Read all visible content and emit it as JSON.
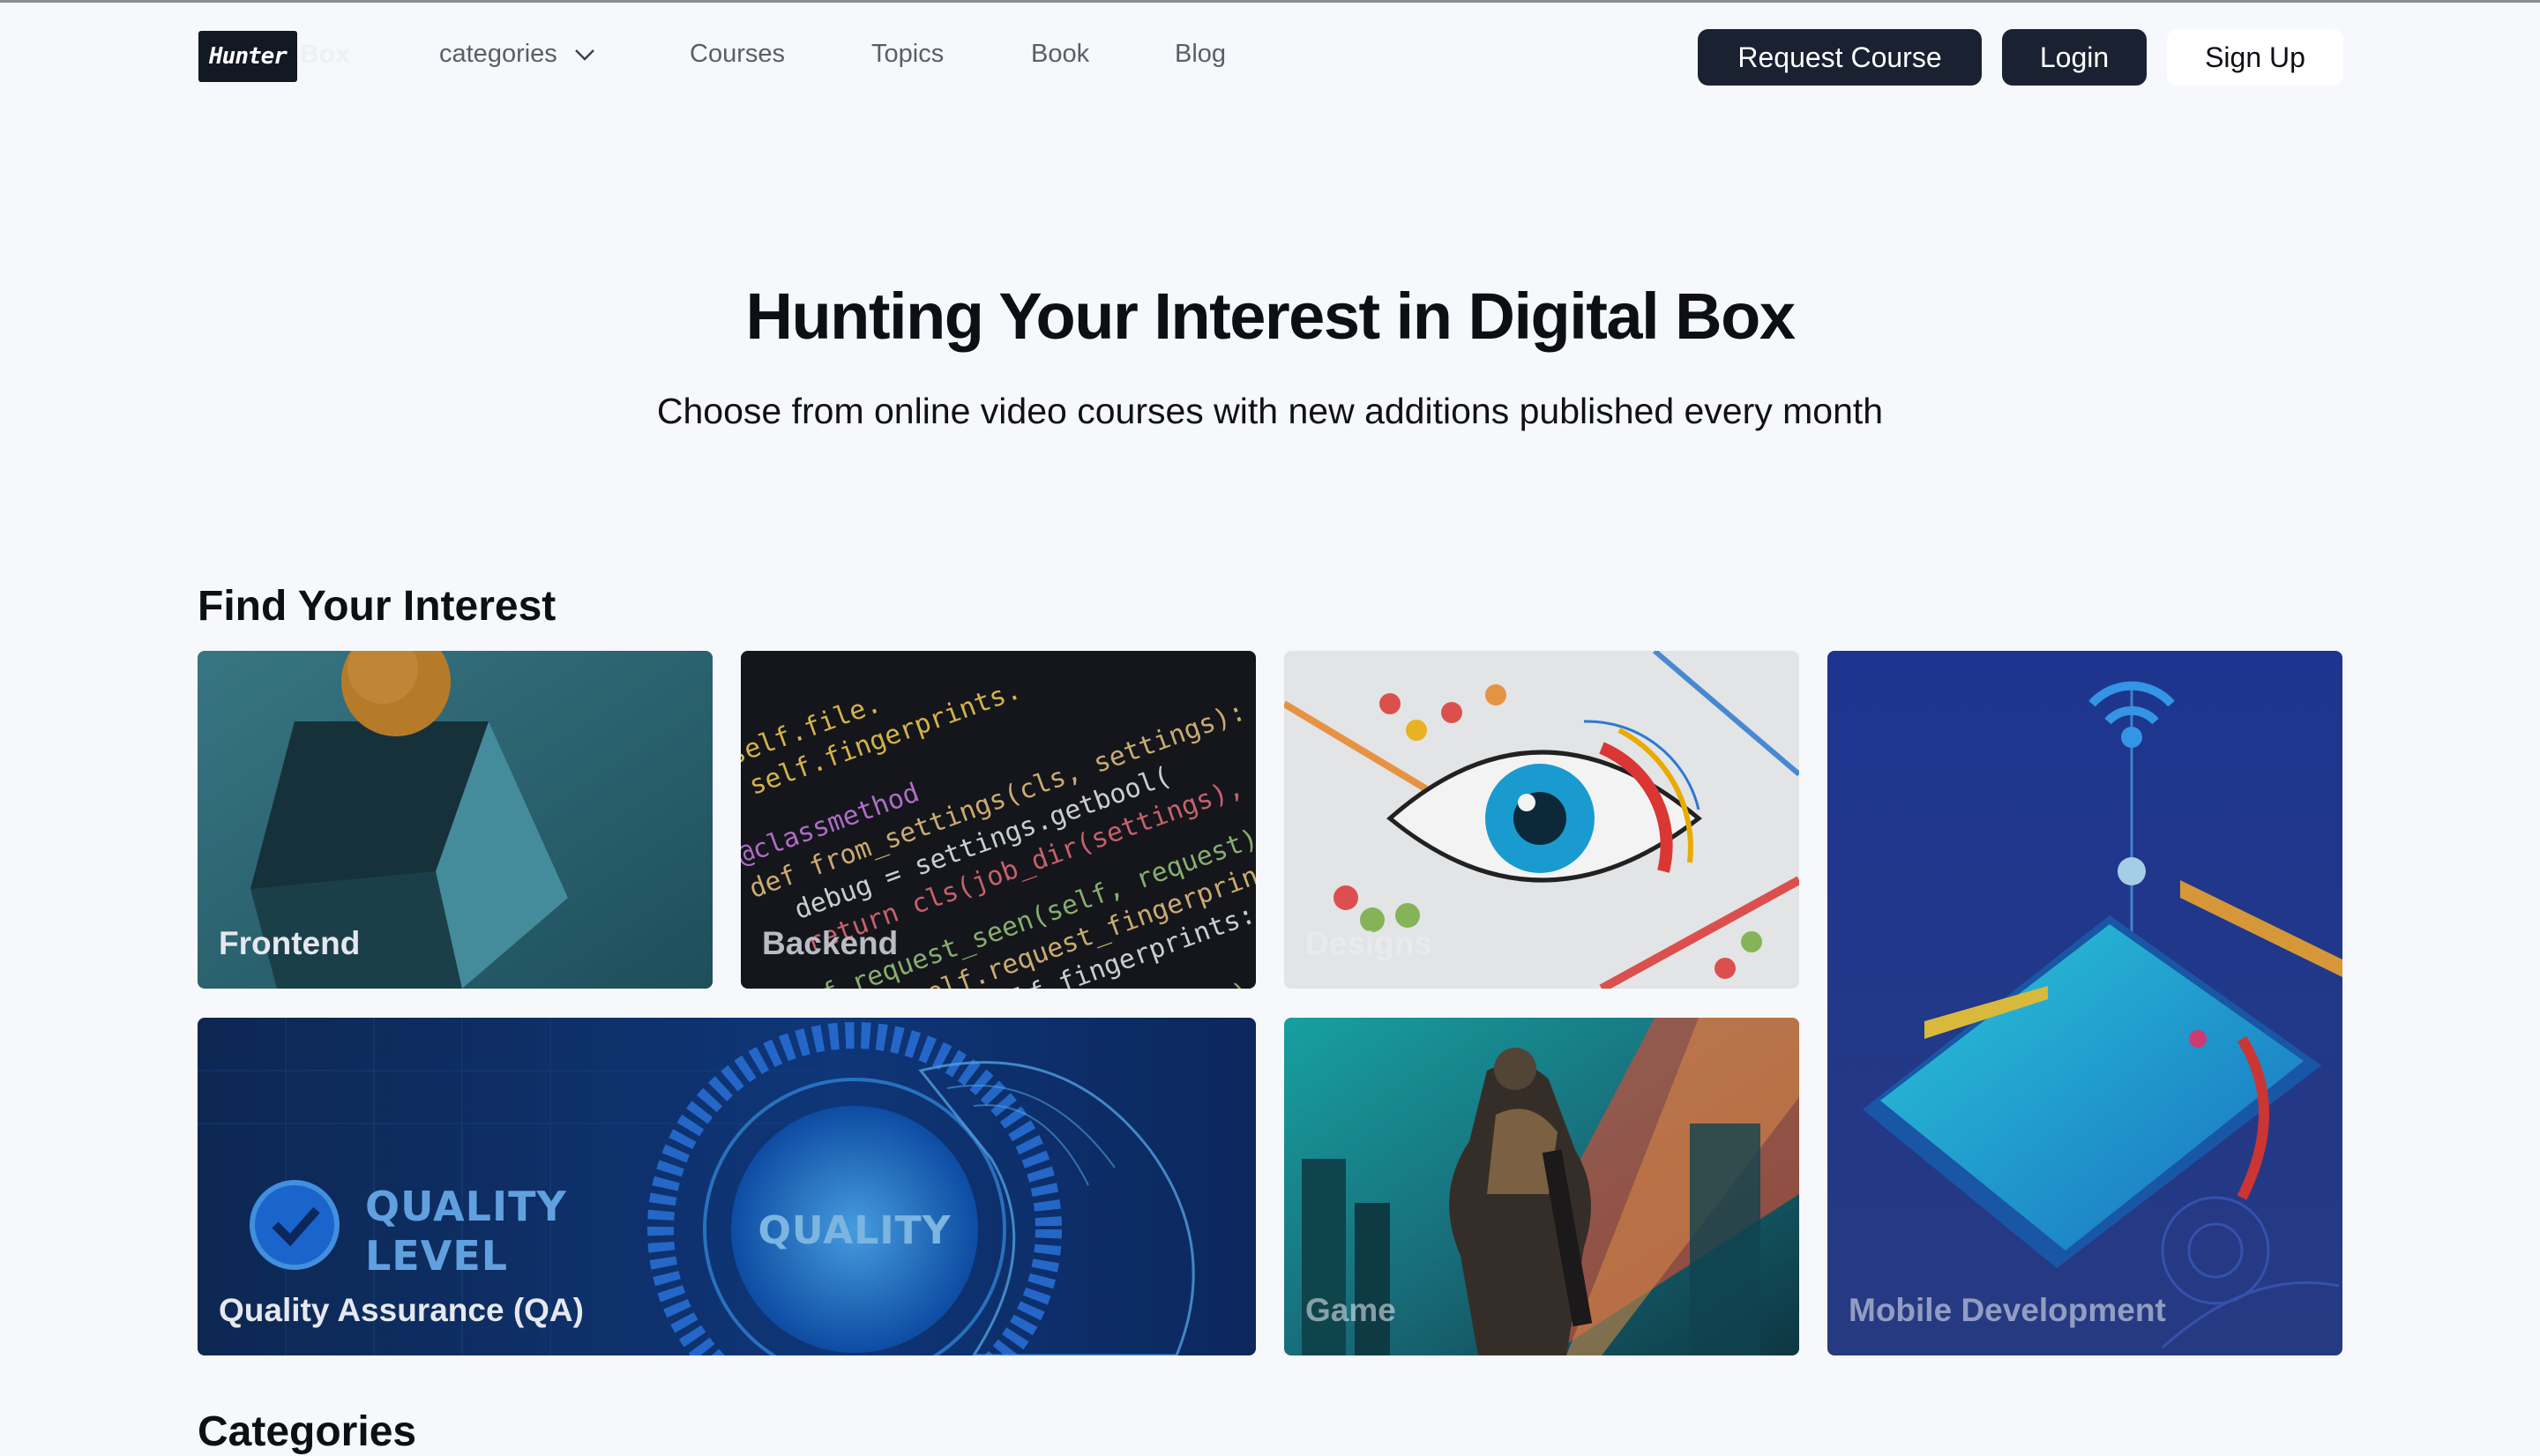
{
  "nav": {
    "logo_text": "Hunter",
    "logo_text_faded": "Box",
    "links": {
      "categories": "categories",
      "courses": "Courses",
      "topics": "Topics",
      "book": "Book",
      "blog": "Blog"
    },
    "buttons": {
      "request_course": "Request Course",
      "login": "Login",
      "sign_up": "Sign Up"
    }
  },
  "hero": {
    "title": "Hunting Your Interest in Digital Box",
    "subtitle": "Choose from online video courses with new additions published every month"
  },
  "find_interest": {
    "heading": "Find Your Interest",
    "cards": [
      {
        "label": "Frontend"
      },
      {
        "label": "Backend"
      },
      {
        "label": "Designs"
      },
      {
        "label": "Mobile Development"
      },
      {
        "label": "Quality Assurance (QA)"
      },
      {
        "label": "Game"
      }
    ],
    "qa_badge_line1": "QUALITY",
    "qa_badge_line2": "LEVEL",
    "qa_knob_text": "QUALITY"
  },
  "categories": {
    "heading": "Categories"
  },
  "colors": {
    "page_bg": "#f6f8fb",
    "primary_button": "#1a2130",
    "text": "#0d0f14",
    "nav_link": "#5a5e66"
  }
}
